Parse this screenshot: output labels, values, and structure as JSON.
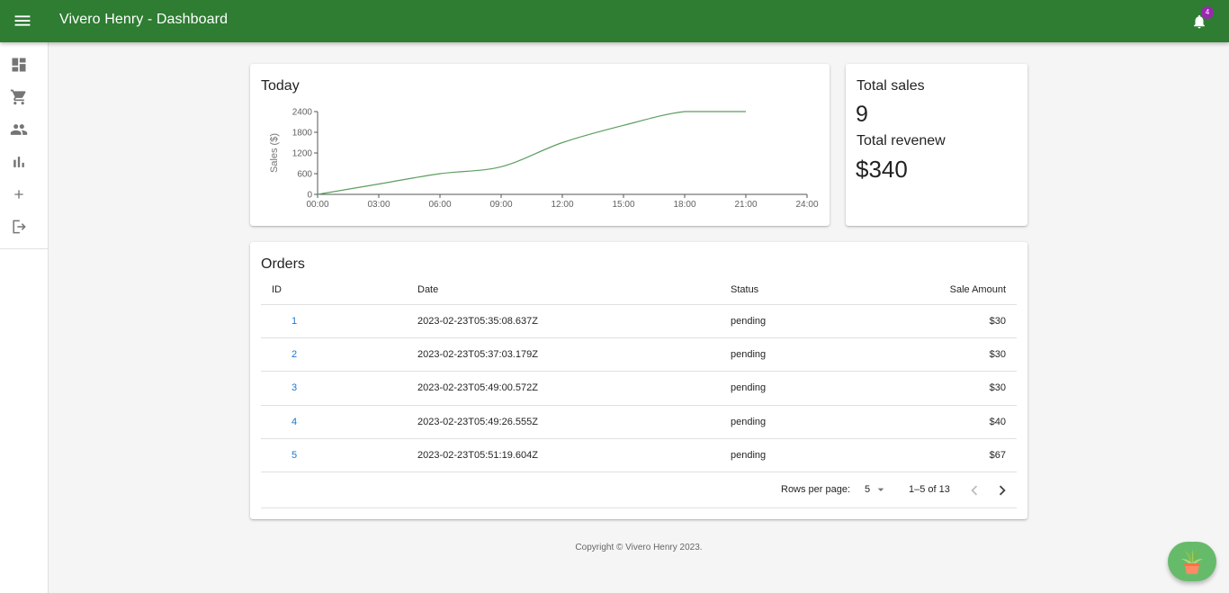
{
  "header": {
    "title": "Vivero Henry - Dashboard",
    "notification_count": "4",
    "color": "#2e7d32"
  },
  "sidebar": {
    "items": [
      {
        "icon": "dashboard-icon"
      },
      {
        "icon": "shopping-cart-icon"
      },
      {
        "icon": "people-icon"
      },
      {
        "icon": "bar-chart-icon"
      },
      {
        "icon": "add-icon"
      },
      {
        "icon": "logout-icon"
      }
    ]
  },
  "today": {
    "title": "Today"
  },
  "chart_data": {
    "type": "line",
    "title": "Today",
    "ylabel": "Sales ($)",
    "xlabel": "",
    "x": [
      "00:00",
      "03:00",
      "06:00",
      "09:00",
      "12:00",
      "15:00",
      "18:00",
      "21:00"
    ],
    "values": [
      0,
      300,
      600,
      800,
      1500,
      2000,
      2400,
      2400
    ],
    "xticks": [
      "00:00",
      "03:00",
      "06:00",
      "09:00",
      "12:00",
      "15:00",
      "18:00",
      "21:00",
      "24:00"
    ],
    "yticks": [
      0,
      600,
      1200,
      1800,
      2400
    ],
    "ylim": [
      0,
      2400
    ],
    "xlim_hours": [
      0,
      24
    ],
    "line_color": "#5c9e5f",
    "grid": false
  },
  "stats": {
    "total_sales_label": "Total sales",
    "total_sales_value": "9",
    "total_revenue_label": "Total revenew",
    "total_revenue_value": "$340"
  },
  "orders": {
    "title": "Orders",
    "columns": {
      "id": "ID",
      "date": "Date",
      "status": "Status",
      "amount": "Sale Amount"
    },
    "rows": [
      {
        "id": "1",
        "date": "2023-02-23T05:35:08.637Z",
        "status": "pending",
        "amount": "$30"
      },
      {
        "id": "2",
        "date": "2023-02-23T05:37:03.179Z",
        "status": "pending",
        "amount": "$30"
      },
      {
        "id": "3",
        "date": "2023-02-23T05:49:00.572Z",
        "status": "pending",
        "amount": "$30"
      },
      {
        "id": "4",
        "date": "2023-02-23T05:49:26.555Z",
        "status": "pending",
        "amount": "$40"
      },
      {
        "id": "5",
        "date": "2023-02-23T05:51:19.604Z",
        "status": "pending",
        "amount": "$67"
      }
    ],
    "pagination": {
      "rows_per_page_label": "Rows per page:",
      "rows_per_page_value": "5",
      "range": "1–5 of 13"
    }
  },
  "footer": {
    "copyright": "Copyright © Vivero Henry 2023."
  },
  "fab": {
    "icon": "plant-icon"
  }
}
